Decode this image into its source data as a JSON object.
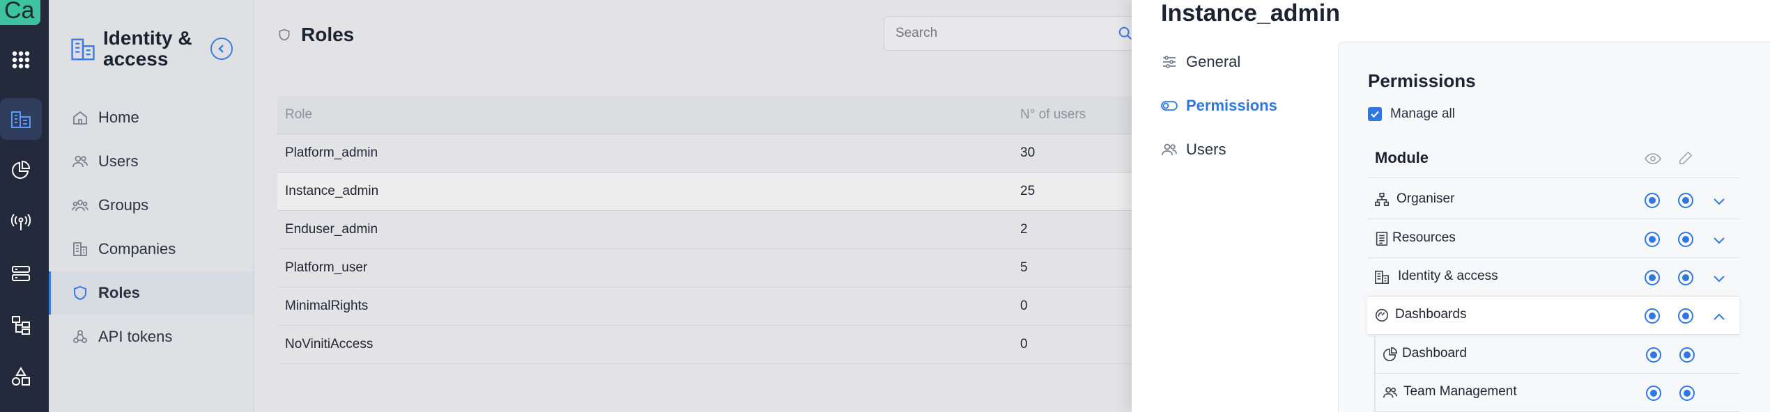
{
  "rail": {
    "logo_text": "Ca",
    "items": [
      {
        "icon": "apps-grid-icon"
      },
      {
        "icon": "building-icon",
        "active": true
      },
      {
        "icon": "pie-chart-icon"
      },
      {
        "icon": "antenna-icon"
      },
      {
        "icon": "server-icon"
      },
      {
        "icon": "hierarchy-icon"
      },
      {
        "icon": "shapes-icon"
      }
    ]
  },
  "subnav": {
    "title": "Identity & access",
    "items": [
      {
        "label": "Home",
        "icon": "home-icon"
      },
      {
        "label": "Users",
        "icon": "users-icon"
      },
      {
        "label": "Groups",
        "icon": "groups-icon"
      },
      {
        "label": "Companies",
        "icon": "companies-icon"
      },
      {
        "label": "Roles",
        "icon": "shield-icon",
        "active": true
      },
      {
        "label": "API tokens",
        "icon": "api-token-icon"
      }
    ]
  },
  "main": {
    "title": "Roles",
    "search_placeholder": "Search",
    "columns": [
      "Role",
      "N° of users"
    ],
    "rows": [
      {
        "role": "Platform_admin",
        "users": "30"
      },
      {
        "role": "Instance_admin",
        "users": "25",
        "selected": true
      },
      {
        "role": "Enduser_admin",
        "users": "2"
      },
      {
        "role": "Platform_user",
        "users": "5"
      },
      {
        "role": "MinimalRights",
        "users": "0"
      },
      {
        "role": "NoVinitiAccess",
        "users": "0"
      }
    ]
  },
  "panel": {
    "title": "Instance_admin",
    "tabs": [
      {
        "label": "General",
        "icon": "sliders-icon"
      },
      {
        "label": "Permissions",
        "icon": "toggle-icon",
        "active": true
      },
      {
        "label": "Users",
        "icon": "users-icon"
      }
    ],
    "permissions": {
      "title": "Permissions",
      "manage_all_label": "Manage all",
      "manage_all_checked": true,
      "module_header": "Module",
      "modules": [
        {
          "label": "Organiser",
          "icon": "org-chart-icon",
          "view": true,
          "edit": true,
          "expanded": false
        },
        {
          "label": "Resources",
          "icon": "document-icon",
          "view": true,
          "edit": true,
          "expanded": false
        },
        {
          "label": "Identity & access",
          "icon": "building-icon",
          "view": true,
          "edit": true,
          "expanded": false
        },
        {
          "label": "Dashboards",
          "icon": "gauge-icon",
          "view": true,
          "edit": true,
          "expanded": true
        }
      ],
      "submodules": [
        {
          "label": "Dashboard",
          "icon": "pie-chart-icon",
          "view": true,
          "edit": true
        },
        {
          "label": "Team Management",
          "icon": "users-icon",
          "view": true,
          "edit": true
        }
      ]
    }
  },
  "colors": {
    "rail_bg": "#232a3b",
    "accent": "#2f78e3",
    "logo_bg": "#3ec3a0"
  }
}
